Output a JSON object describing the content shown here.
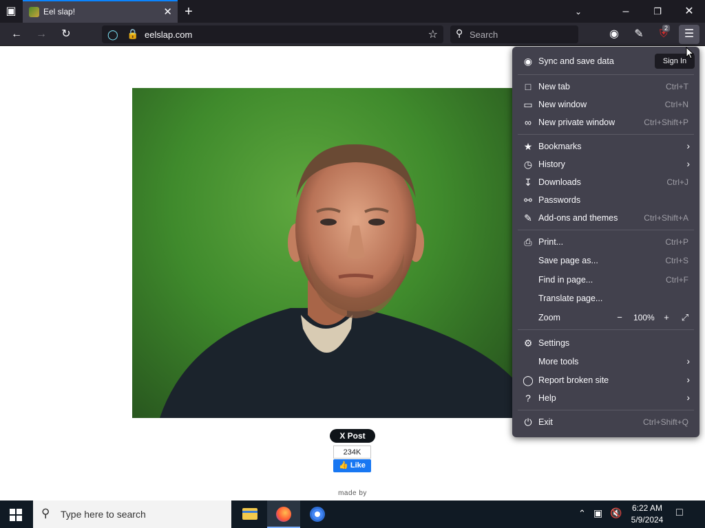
{
  "browser": {
    "tab_title": "Eel slap!",
    "url": "eelslap.com",
    "search_placeholder": "Search",
    "extension_badge": "2"
  },
  "page": {
    "tweet_label": "X Post",
    "like_count": "234K",
    "like_label": "Like",
    "made_by": "made by"
  },
  "menu": {
    "sync_label": "Sync and save data",
    "signin_label": "Sign In",
    "new_tab": "New tab",
    "new_tab_sc": "Ctrl+T",
    "new_window": "New window",
    "new_window_sc": "Ctrl+N",
    "new_private": "New private window",
    "new_private_sc": "Ctrl+Shift+P",
    "bookmarks": "Bookmarks",
    "history": "History",
    "downloads": "Downloads",
    "downloads_sc": "Ctrl+J",
    "passwords": "Passwords",
    "addons": "Add-ons and themes",
    "addons_sc": "Ctrl+Shift+A",
    "print": "Print...",
    "print_sc": "Ctrl+P",
    "save_page": "Save page as...",
    "save_page_sc": "Ctrl+S",
    "find": "Find in page...",
    "find_sc": "Ctrl+F",
    "translate": "Translate page...",
    "zoom": "Zoom",
    "zoom_level": "100%",
    "settings": "Settings",
    "more_tools": "More tools",
    "report": "Report broken site",
    "help": "Help",
    "exit": "Exit",
    "exit_sc": "Ctrl+Shift+Q"
  },
  "taskbar": {
    "search_placeholder": "Type here to search",
    "time": "6:22 AM",
    "date": "5/9/2024"
  },
  "colors": {
    "accent": "#0a84ff",
    "menu_bg": "#42414d",
    "toolbar_bg": "#2b2a33"
  }
}
